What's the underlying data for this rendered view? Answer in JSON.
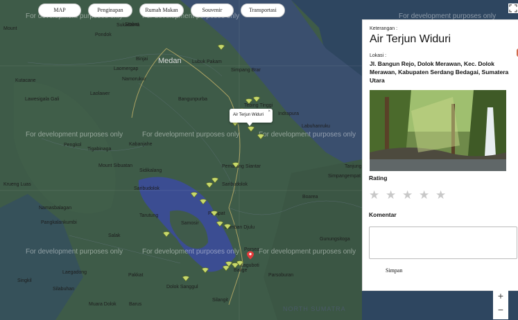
{
  "tabs": [
    {
      "label": "MAP"
    },
    {
      "label": "Penginapan"
    },
    {
      "label": "Rumah Makan"
    },
    {
      "label": "Souvenir"
    },
    {
      "label": "Transportasi"
    }
  ],
  "map": {
    "watermark": "For development purposes only",
    "region_label": "NORTH SUMATRA",
    "places": {
      "medan": "Medan",
      "lubuk_pakam": "Lubuk Pakam",
      "tebing_tinggi": "Tebing Tinggi",
      "pematang_siantar": "Pematang Siantar",
      "saribudolok": "Saribudolok",
      "parapat": "Parapat",
      "balige": "Balige",
      "siantar_lbl": "Siantar",
      "sibolga": "Pangkalankumbi",
      "stabat": "Stabat",
      "binjai": "Binjai",
      "pondok": "Pondok",
      "sukadama": "Sukadama",
      "laomergap": "Laomergap",
      "namorukur": "Namorukur",
      "kutacane": "Kutacane",
      "laolawer": "Laolawer",
      "lawesigala": "Lawesigala Gali",
      "pengkal": "Pengkol",
      "tigabinaga": "Tigabinaga",
      "kabanjahe": "Kabanjahe",
      "sibolangit": "Sibolangit",
      "bangunpurba": "Bangunpurba",
      "indrapura": "Indrapura",
      "labuhanruku": "Labuhanruku",
      "simpangempat": "Simpangempat",
      "tanjung": "Tanjung",
      "boarea": "Boarea",
      "sidikalang": "Sidikalang",
      "salak": "Salak",
      "samosir": "Samosir",
      "lumban_djulu": "Lumban Djulu",
      "porsea": "Porsea",
      "laguboti": "Laguboti",
      "dolok_sanggul": "Dolok Sanggul",
      "siborong": "Silangit",
      "parsoburan": "Parsoburan",
      "gunungsitoga": "Gunungsitoga",
      "tarutung": "Tarutung",
      "laegadong": "Laegadong",
      "pakkat": "Pakkat",
      "muara_dolok": "Muara Dolok",
      "singkil": "Singkil",
      "silabuhan": "Silabuhan",
      "kruengluas": "Krueng Luas",
      "barus": "Barus",
      "nansidlangga": "Namasbalagan",
      "mount_sibuatan": "Mount Sibuatan",
      "mount": "Mount",
      "sarbudiris": "Saribudolok",
      "simpangbrar": "Simpang Brar"
    },
    "popup": {
      "text": "Air Terjun Widuri",
      "close": "×"
    }
  },
  "panel": {
    "keterangan_label": "Keterangan :",
    "title": "Air Terjun Widuri",
    "lokasi_label": "Lokasi :",
    "address": "Jl. Bangun Rejo, Dolok Merawan, Kec. Dolok Merawan, Kabupaten Serdang Bedagai, Sumatera Utara",
    "rating_label": "Rating",
    "stars": [
      "★",
      "★",
      "★",
      "★",
      "★"
    ],
    "komentar_label": "Komentar",
    "save_label": "Simpan"
  },
  "zoom": {
    "in": "+",
    "out": "−"
  },
  "colors": {
    "marker": "#c7d86b",
    "selected_marker": "#e23b3b",
    "land": "#3a5a4c",
    "water": "#3d4e8a"
  }
}
